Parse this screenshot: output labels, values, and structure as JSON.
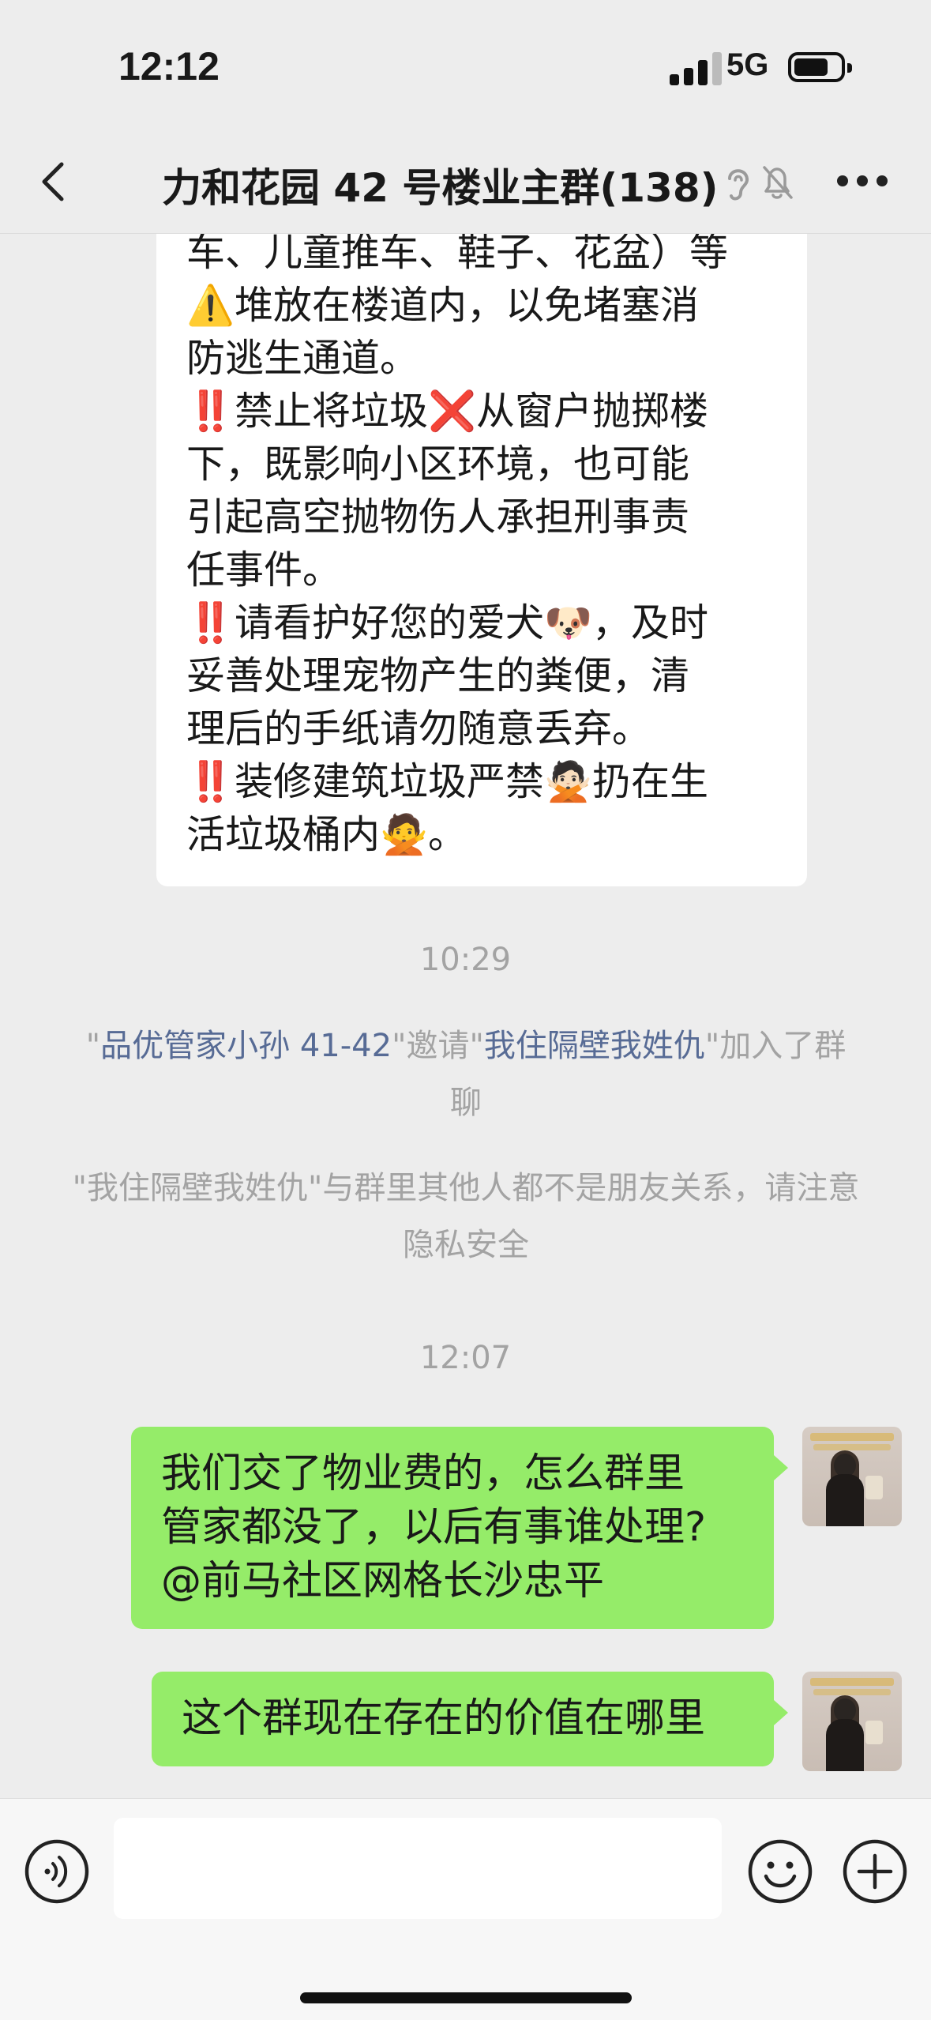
{
  "status_bar": {
    "time": "12:12",
    "network": "5G"
  },
  "header": {
    "title": "力和花园 42 号楼业主群(138)"
  },
  "messages": {
    "notice_lines": [
      "车、儿童推车、鞋子、花盆）等",
      "⚠️堆放在楼道内，以免堵塞消",
      "防逃生通道。",
      "‼️禁止将垃圾❌从窗户抛掷楼",
      "下，既影响小区环境，也可能",
      "引起高空抛物伤人承担刑事责",
      "任事件。",
      "‼️请看护好您的爱犬🐶，及时",
      "妥善处理宠物产生的粪便，清",
      "理后的手纸请勿随意丢弃。",
      "‼️装修建筑垃圾严禁🙅🏻扔在生",
      "活垃圾桶内🙅。"
    ],
    "time_1": "10:29",
    "invite": {
      "q1": "\"",
      "inviter": "品优管家小孙 41-42",
      "mid": "\"邀请\"",
      "invitee": "我住隔壁我姓仇",
      "end": "\"加入了群聊"
    },
    "privacy_notice": "\"我住隔壁我姓仇\"与群里其他人都不是朋友关系，请注意隐私安全",
    "time_2": "12:07",
    "my_msg_1_lines": [
      "我们交了物业费的，怎么群里",
      "管家都没了，以后有事谁处理?",
      "@前马社区网格长沙忠平"
    ],
    "my_msg_2": "这个群现在存在的价值在哪里"
  },
  "icons": {
    "back": "chevron-left-icon",
    "ear": "ear-icon",
    "mute": "bell-off-icon",
    "more": "more-dots-icon",
    "voice": "voice-icon",
    "emoji": "emoji-icon",
    "plus": "plus-icon"
  },
  "colors": {
    "my_bubble": "#95ec69",
    "name_link": "#576b95",
    "background": "#ededed"
  }
}
